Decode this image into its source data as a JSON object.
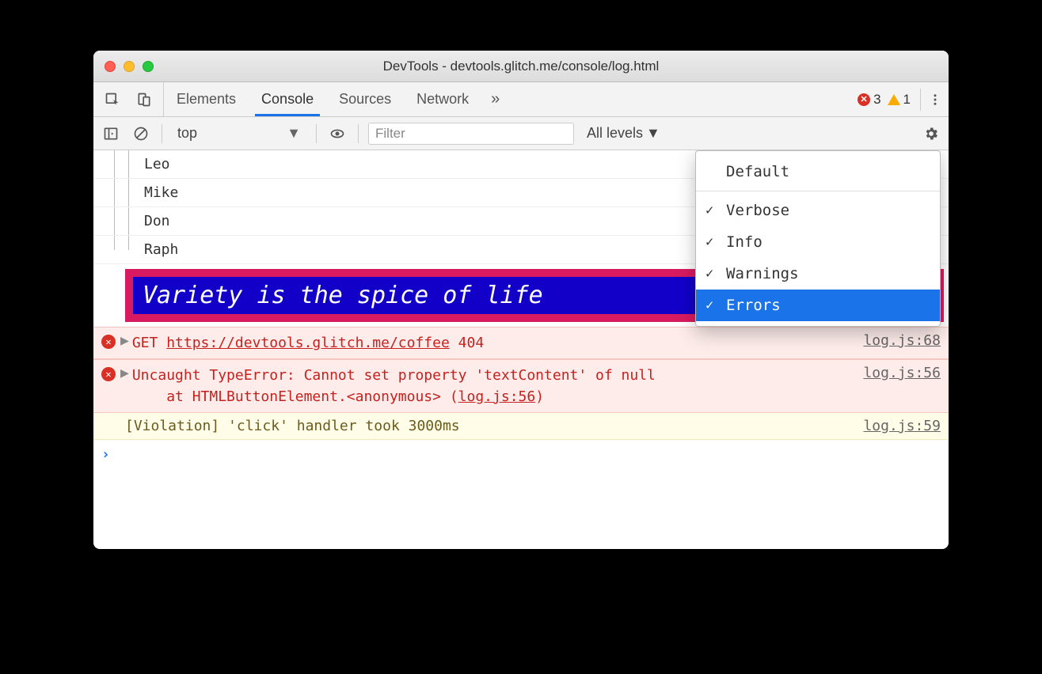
{
  "window": {
    "title": "DevTools - devtools.glitch.me/console/log.html"
  },
  "tabs": {
    "items": [
      "Elements",
      "Console",
      "Sources",
      "Network"
    ],
    "active_index": 1,
    "overflow_glyph": "»",
    "error_count": "3",
    "warning_count": "1"
  },
  "console_toolbar": {
    "context": "top",
    "filter_placeholder": "Filter",
    "levels_label": "All levels"
  },
  "log_group": {
    "items": [
      "Leo",
      "Mike",
      "Don",
      "Raph"
    ]
  },
  "styled_message": "Variety is the spice of life",
  "errors": [
    {
      "prefix": "GET",
      "url": "https://devtools.glitch.me/coffee",
      "status": "404",
      "source": "log.js:68"
    },
    {
      "line1": "Uncaught TypeError: Cannot set property 'textContent' of null",
      "line2_prefix": "at HTMLButtonElement.<anonymous> (",
      "line2_link": "log.js:56",
      "line2_suffix": ")",
      "source": "log.js:56"
    }
  ],
  "violation": {
    "text": "[Violation] 'click' handler took 3000ms",
    "source": "log.js:59"
  },
  "levels_menu": {
    "default_label": "Default",
    "options": [
      {
        "label": "Verbose",
        "checked": true,
        "selected": false
      },
      {
        "label": "Info",
        "checked": true,
        "selected": false
      },
      {
        "label": "Warnings",
        "checked": true,
        "selected": false
      },
      {
        "label": "Errors",
        "checked": true,
        "selected": true
      }
    ]
  }
}
